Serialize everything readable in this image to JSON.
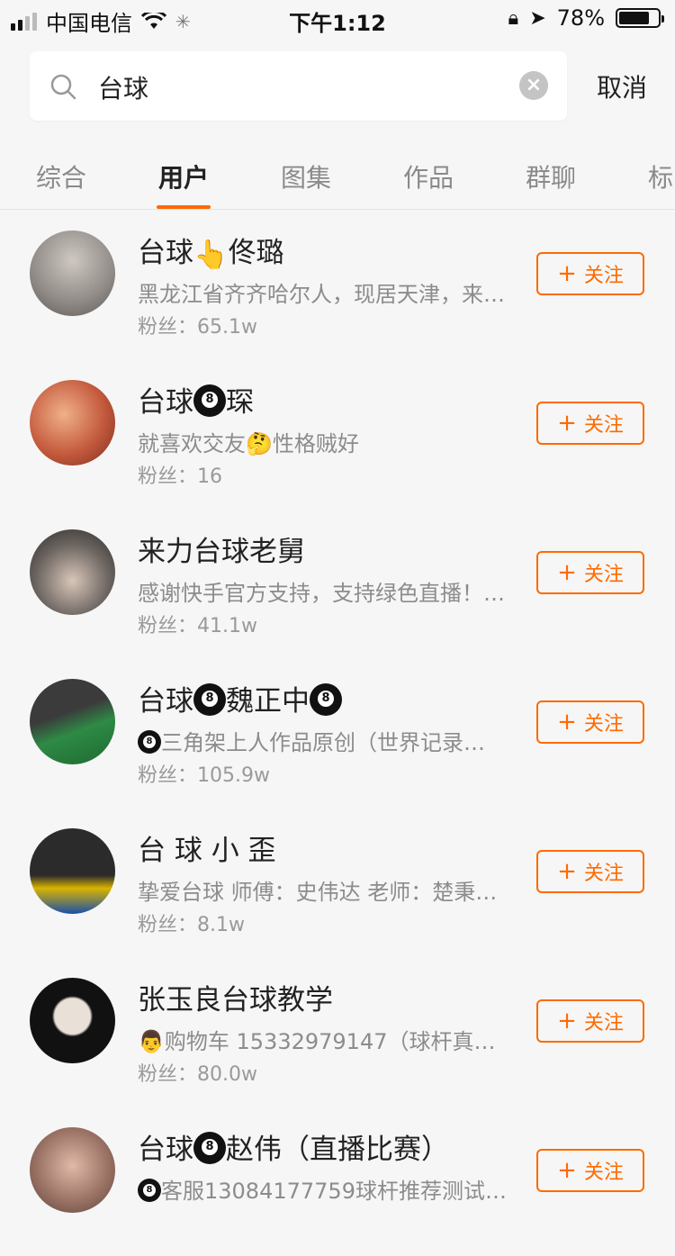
{
  "status": {
    "carrier": "中国电信",
    "time": "下午1:12",
    "battery_pct": "78%",
    "battery_level": 0.78
  },
  "search": {
    "query": "台球",
    "cancel": "取消"
  },
  "tabs": [
    {
      "label": "综合",
      "active": false
    },
    {
      "label": "用户",
      "active": true
    },
    {
      "label": "图集",
      "active": false
    },
    {
      "label": "作品",
      "active": false
    },
    {
      "label": "群聊",
      "active": false
    },
    {
      "label": "标",
      "active": false
    }
  ],
  "follow_label": "关注",
  "users": [
    {
      "name_a": "台球",
      "name_emoji": "👆",
      "name_b": "佟璐",
      "desc": "黑龙江省齐齐哈尔人，现居天津，来…",
      "fans": "粉丝：65.1w",
      "avatar_color": "#8f8a86"
    },
    {
      "name_a": "台球",
      "name_b": "琛",
      "desc_a": "就喜欢交友",
      "desc_emoji": "🤔",
      "desc_b": "性格贼好",
      "fans": "粉丝：16",
      "avatar_color": "#c45a3d"
    },
    {
      "name": "来力台球老舅",
      "desc": "感谢快手官方支持，支持绿色直播！…",
      "fans": "粉丝：41.1w",
      "avatar_color": "#6b6460"
    },
    {
      "name_a": "台球",
      "name_b": "魏正中",
      "desc": "三角架上人作品原创（世界记录…",
      "fans": "粉丝：105.9w",
      "avatar_color": "#2c5c34"
    },
    {
      "name": "台 球 小 歪",
      "desc": "挚爱台球 师傅：史伟达  老师：楚秉…",
      "fans": "粉丝：8.1w",
      "avatar_color": "#2b2b2b"
    },
    {
      "name": "张玉良台球教学",
      "desc_emoji": "👨",
      "desc": "购物车  15332979147（球杆真好…",
      "fans": "粉丝：80.0w",
      "avatar_color": "#111111"
    },
    {
      "name_a": "台球",
      "name_b": "赵伟（直播比赛）",
      "desc": "客服13084177759球杆推荐测试…",
      "avatar_color": "#9c7466"
    }
  ],
  "colors": {
    "accent": "#ff6a00"
  }
}
